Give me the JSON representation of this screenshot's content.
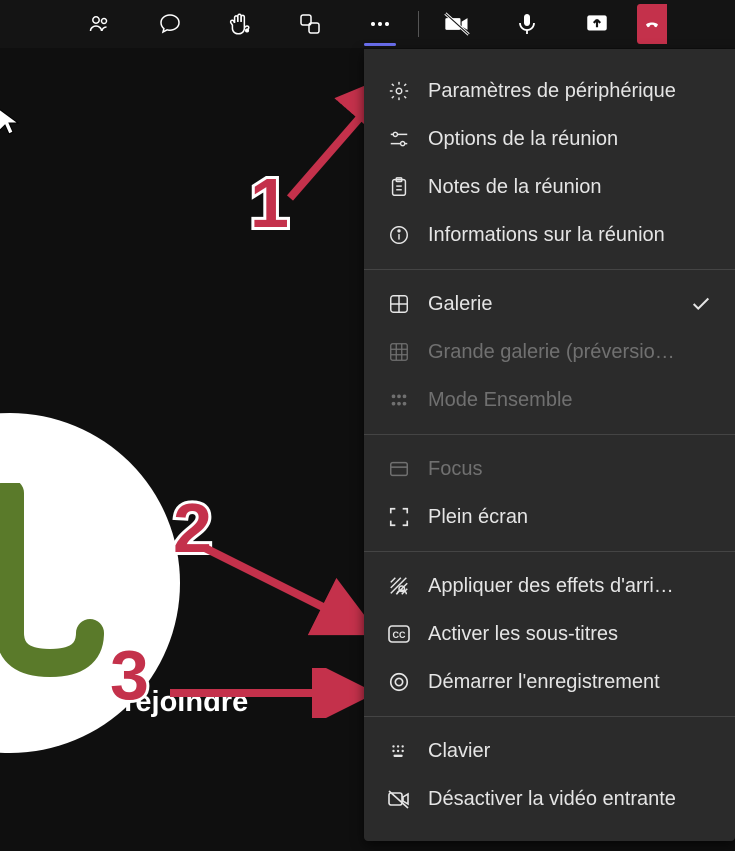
{
  "toolbar": {
    "icons": [
      "people",
      "chat",
      "raise-hand",
      "rooms",
      "more",
      "camera-off",
      "mic",
      "share",
      "leave"
    ]
  },
  "main_text": "s à vous rejoindre",
  "menu": {
    "section1": [
      {
        "icon": "gear",
        "label": "Paramètres de périphérique"
      },
      {
        "icon": "sliders",
        "label": "Options de la réunion"
      },
      {
        "icon": "notes",
        "label": "Notes de la réunion"
      },
      {
        "icon": "info",
        "label": "Informations sur la réunion"
      }
    ],
    "section2": [
      {
        "icon": "gallery",
        "label": "Galerie",
        "checked": true
      },
      {
        "icon": "large-gallery",
        "label": "Grande galerie (préversio…",
        "disabled": true
      },
      {
        "icon": "together",
        "label": "Mode Ensemble",
        "disabled": true
      }
    ],
    "section3": [
      {
        "icon": "focus",
        "label": "Focus",
        "disabled": true
      },
      {
        "icon": "fullscreen",
        "label": "Plein écran"
      }
    ],
    "section4": [
      {
        "icon": "effects",
        "label": "Appliquer des effets d'arri…"
      },
      {
        "icon": "cc",
        "label": "Activer les sous-titres"
      },
      {
        "icon": "record",
        "label": "Démarrer l'enregistrement"
      }
    ],
    "section5": [
      {
        "icon": "keyboard",
        "label": "Clavier"
      },
      {
        "icon": "video-off",
        "label": "Désactiver la vidéo entrante"
      }
    ]
  },
  "annotations": {
    "n1": "1",
    "n2": "2",
    "n3": "3"
  }
}
